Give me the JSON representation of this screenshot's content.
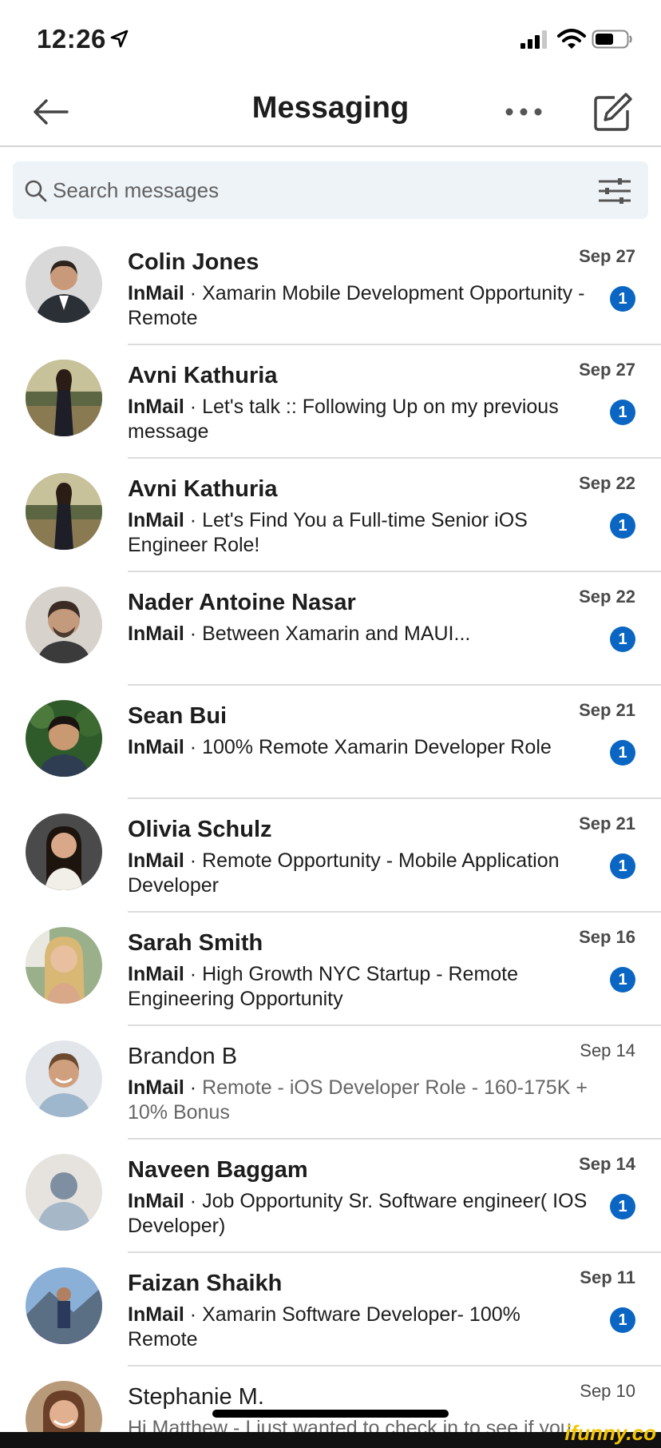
{
  "status_bar": {
    "time": "12:26"
  },
  "header": {
    "title": "Messaging"
  },
  "search": {
    "placeholder": "Search messages",
    "value": ""
  },
  "colors": {
    "accent": "#0a66c2",
    "search_bg": "#eef3f8",
    "divider": "#dcdcdc"
  },
  "conversations": [
    {
      "name": "Colin Jones",
      "date": "Sep 27",
      "tag": "InMail",
      "sep": " · ",
      "text": "Xamarin Mobile Development Opportunity - Remote",
      "unread": "1",
      "avatar_icon": "colin-jones-avatar"
    },
    {
      "name": "Avni Kathuria",
      "date": "Sep 27",
      "tag": "InMail",
      "sep": " · ",
      "text": "Let's talk :: Following Up on my previous message",
      "unread": "1",
      "avatar_icon": "avni-kathuria-avatar"
    },
    {
      "name": "Avni Kathuria",
      "date": "Sep 22",
      "tag": "InMail",
      "sep": " · ",
      "text": "Let's Find You a Full-time Senior iOS Engineer Role!",
      "unread": "1",
      "avatar_icon": "avni-kathuria-avatar"
    },
    {
      "name": "Nader Antoine Nasar",
      "date": "Sep 22",
      "tag": "InMail",
      "sep": " · ",
      "text": "Between Xamarin and MAUI...",
      "unread": "1",
      "avatar_icon": "nader-nasar-avatar"
    },
    {
      "name": "Sean Bui",
      "date": "Sep 21",
      "tag": "InMail",
      "sep": " · ",
      "text": "100% Remote Xamarin Developer Role",
      "unread": "1",
      "avatar_icon": "sean-bui-avatar"
    },
    {
      "name": "Olivia Schulz",
      "date": "Sep 21",
      "tag": "InMail",
      "sep": " · ",
      "text": "Remote Opportunity - Mobile Application Developer",
      "unread": "1",
      "avatar_icon": "olivia-schulz-avatar"
    },
    {
      "name": "Sarah Smith",
      "date": "Sep 16",
      "tag": "InMail",
      "sep": " · ",
      "text": "High Growth NYC Startup - Remote Engineering Opportunity",
      "unread": "1",
      "avatar_icon": "sarah-smith-avatar"
    },
    {
      "name": "Brandon B",
      "date": "Sep 14",
      "tag": "InMail",
      "sep": " · ",
      "text": "Remote - iOS Developer Role - 160-175K + 10% Bonus",
      "unread": "",
      "avatar_icon": "brandon-b-avatar"
    },
    {
      "name": "Naveen Baggam",
      "date": "Sep 14",
      "tag": "InMail",
      "sep": " · ",
      "text": "Job Opportunity Sr. Software engineer( IOS Developer)",
      "unread": "1",
      "avatar_icon": "default-person-avatar"
    },
    {
      "name": "Faizan Shaikh",
      "date": "Sep 11",
      "tag": "InMail",
      "sep": " · ",
      "text": "Xamarin Software Developer- 100% Remote",
      "unread": "1",
      "avatar_icon": "faizan-shaikh-avatar"
    },
    {
      "name": "Stephanie M.",
      "date": "Sep 10",
      "tag": "",
      "sep": "",
      "text": "Hi Matthew - I just wanted to check in to see if you...",
      "unread": "",
      "avatar_icon": "stephanie-m-avatar"
    }
  ],
  "watermark": "ifunny.co"
}
